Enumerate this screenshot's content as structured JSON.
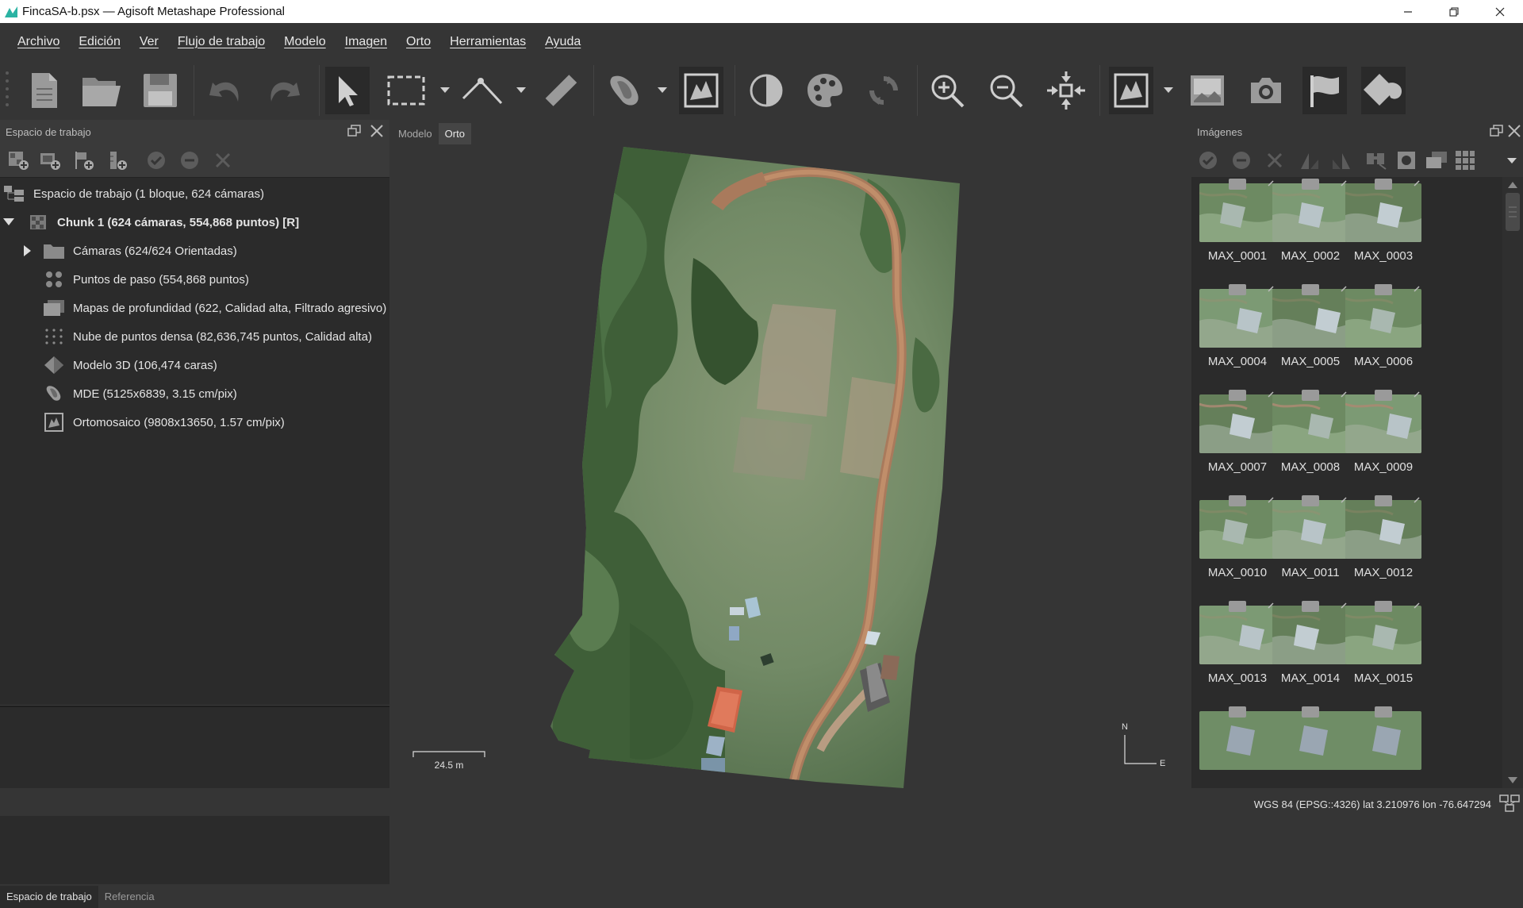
{
  "window": {
    "title": "FincaSA-b.psx — Agisoft Metashape Professional",
    "minimize_icon": "minimize-icon",
    "restore_icon": "restore-icon",
    "close_icon": "close-icon"
  },
  "menu": [
    "Archivo",
    "Edición",
    "Ver",
    "Flujo de trabajo",
    "Modelo",
    "Imagen",
    "Orto",
    "Herramientas",
    "Ayuda"
  ],
  "toolbar": {
    "buttons": [
      "new-document-icon",
      "open-folder-icon",
      "save-icon",
      "undo-icon",
      "redo-icon",
      "select-pointer-icon",
      "rectangle-selection-icon",
      "ruler-shape-icon",
      "ruler-icon",
      "dem-icon",
      "orthomosaic-icon",
      "contrast-icon",
      "palette-icon",
      "refresh-icon",
      "zoom-in-icon",
      "zoom-out-icon",
      "reset-view-icon",
      "ortho-view-icon",
      "image-icon",
      "camera-icon",
      "flag-icon",
      "shape-icon"
    ]
  },
  "workspace": {
    "header": "Espacio de trabajo",
    "root_label": "Espacio de trabajo (1 bloque, 624 cámaras)",
    "chunk_label": "Chunk 1 (624 cámaras, 554,868 puntos) [R]",
    "items": [
      {
        "label": "Cámaras (624/624 Orientadas)",
        "icon": "folder-icon"
      },
      {
        "label": "Puntos de paso (554,868 puntos)",
        "icon": "tie-points-icon"
      },
      {
        "label": "Mapas de profundidad (622, Calidad alta, Filtrado agresivo)",
        "icon": "depth-maps-icon"
      },
      {
        "label": "Nube de puntos densa (82,636,745 puntos, Calidad alta)",
        "icon": "dense-cloud-icon"
      },
      {
        "label": "Modelo 3D (106,474 caras)",
        "icon": "model-3d-icon"
      },
      {
        "label": "MDE (5125x6839, 3.15 cm/pix)",
        "icon": "dem-icon"
      },
      {
        "label": "Ortomosaico (9808x13650, 1.57 cm/pix)",
        "icon": "orthomosaic-icon"
      }
    ],
    "bottom_tabs": [
      "Espacio de trabajo",
      "Referencia"
    ]
  },
  "view": {
    "tabs": [
      "Modelo",
      "Orto"
    ],
    "active_tab": "Orto",
    "scale_label": "24.5 m",
    "compass_n": "N",
    "compass_e": "E"
  },
  "images": {
    "header": "Imágenes",
    "thumbnails": [
      "MAX_0001",
      "MAX_0002",
      "MAX_0003",
      "MAX_0004",
      "MAX_0005",
      "MAX_0006",
      "MAX_0007",
      "MAX_0008",
      "MAX_0009",
      "MAX_0010",
      "MAX_0011",
      "MAX_0012",
      "MAX_0013",
      "MAX_0014",
      "MAX_0015"
    ]
  },
  "status": {
    "text": "WGS 84 (EPSG::4326)  lat 3.210976  lon -76.647294"
  }
}
